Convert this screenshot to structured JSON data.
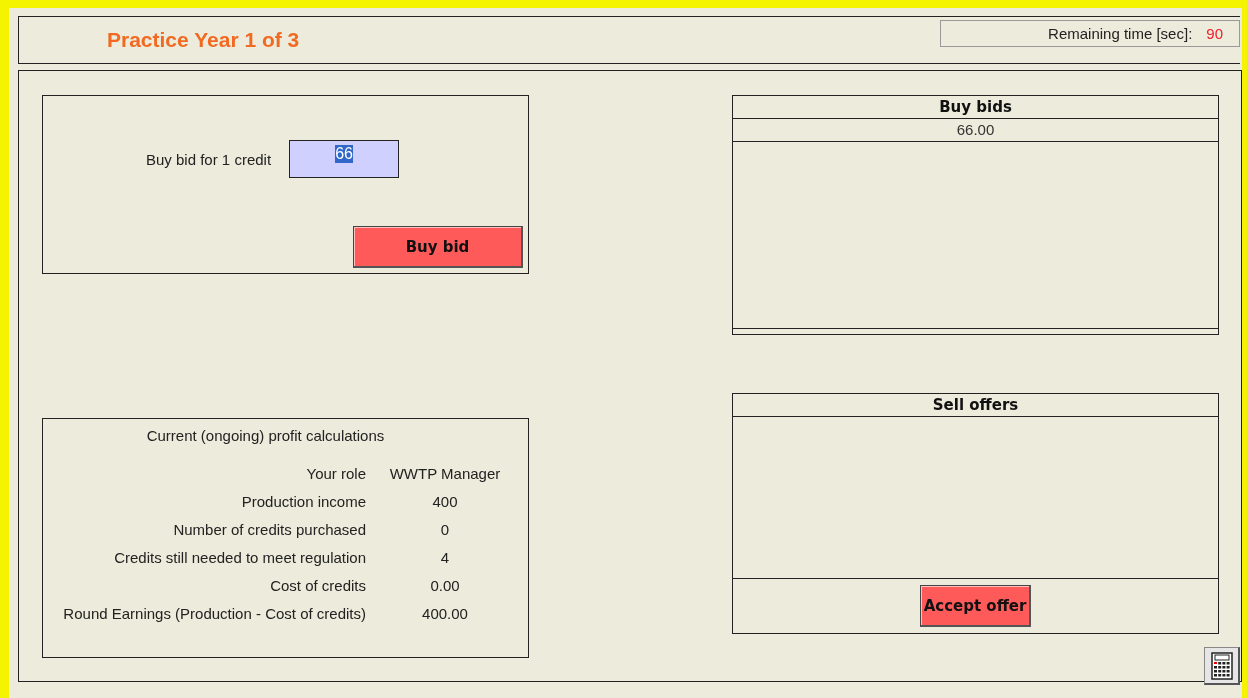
{
  "header": {
    "title": "Practice Year 1 of 3",
    "timer_label": "Remaining time [sec]:",
    "timer_value": "90"
  },
  "bid_form": {
    "label": "Buy bid for 1 credit",
    "value": "66",
    "button": "Buy bid"
  },
  "profit": {
    "title": "Current (ongoing) profit calculations",
    "rows": [
      {
        "label": "Your role",
        "value": "WWTP Manager"
      },
      {
        "label": "Production income",
        "value": "400"
      },
      {
        "label": "Number of credits purchased",
        "value": "0"
      },
      {
        "label": "Credits still needed to meet regulation",
        "value": "4"
      },
      {
        "label": "Cost of credits",
        "value": "0.00"
      },
      {
        "label": "Round Earnings (Production - Cost of credits)",
        "value": "400.00"
      }
    ]
  },
  "buy_bids": {
    "title": "Buy bids",
    "rows": [
      "66.00"
    ]
  },
  "sell_offers": {
    "title": "Sell offers",
    "button": "Accept offer"
  }
}
